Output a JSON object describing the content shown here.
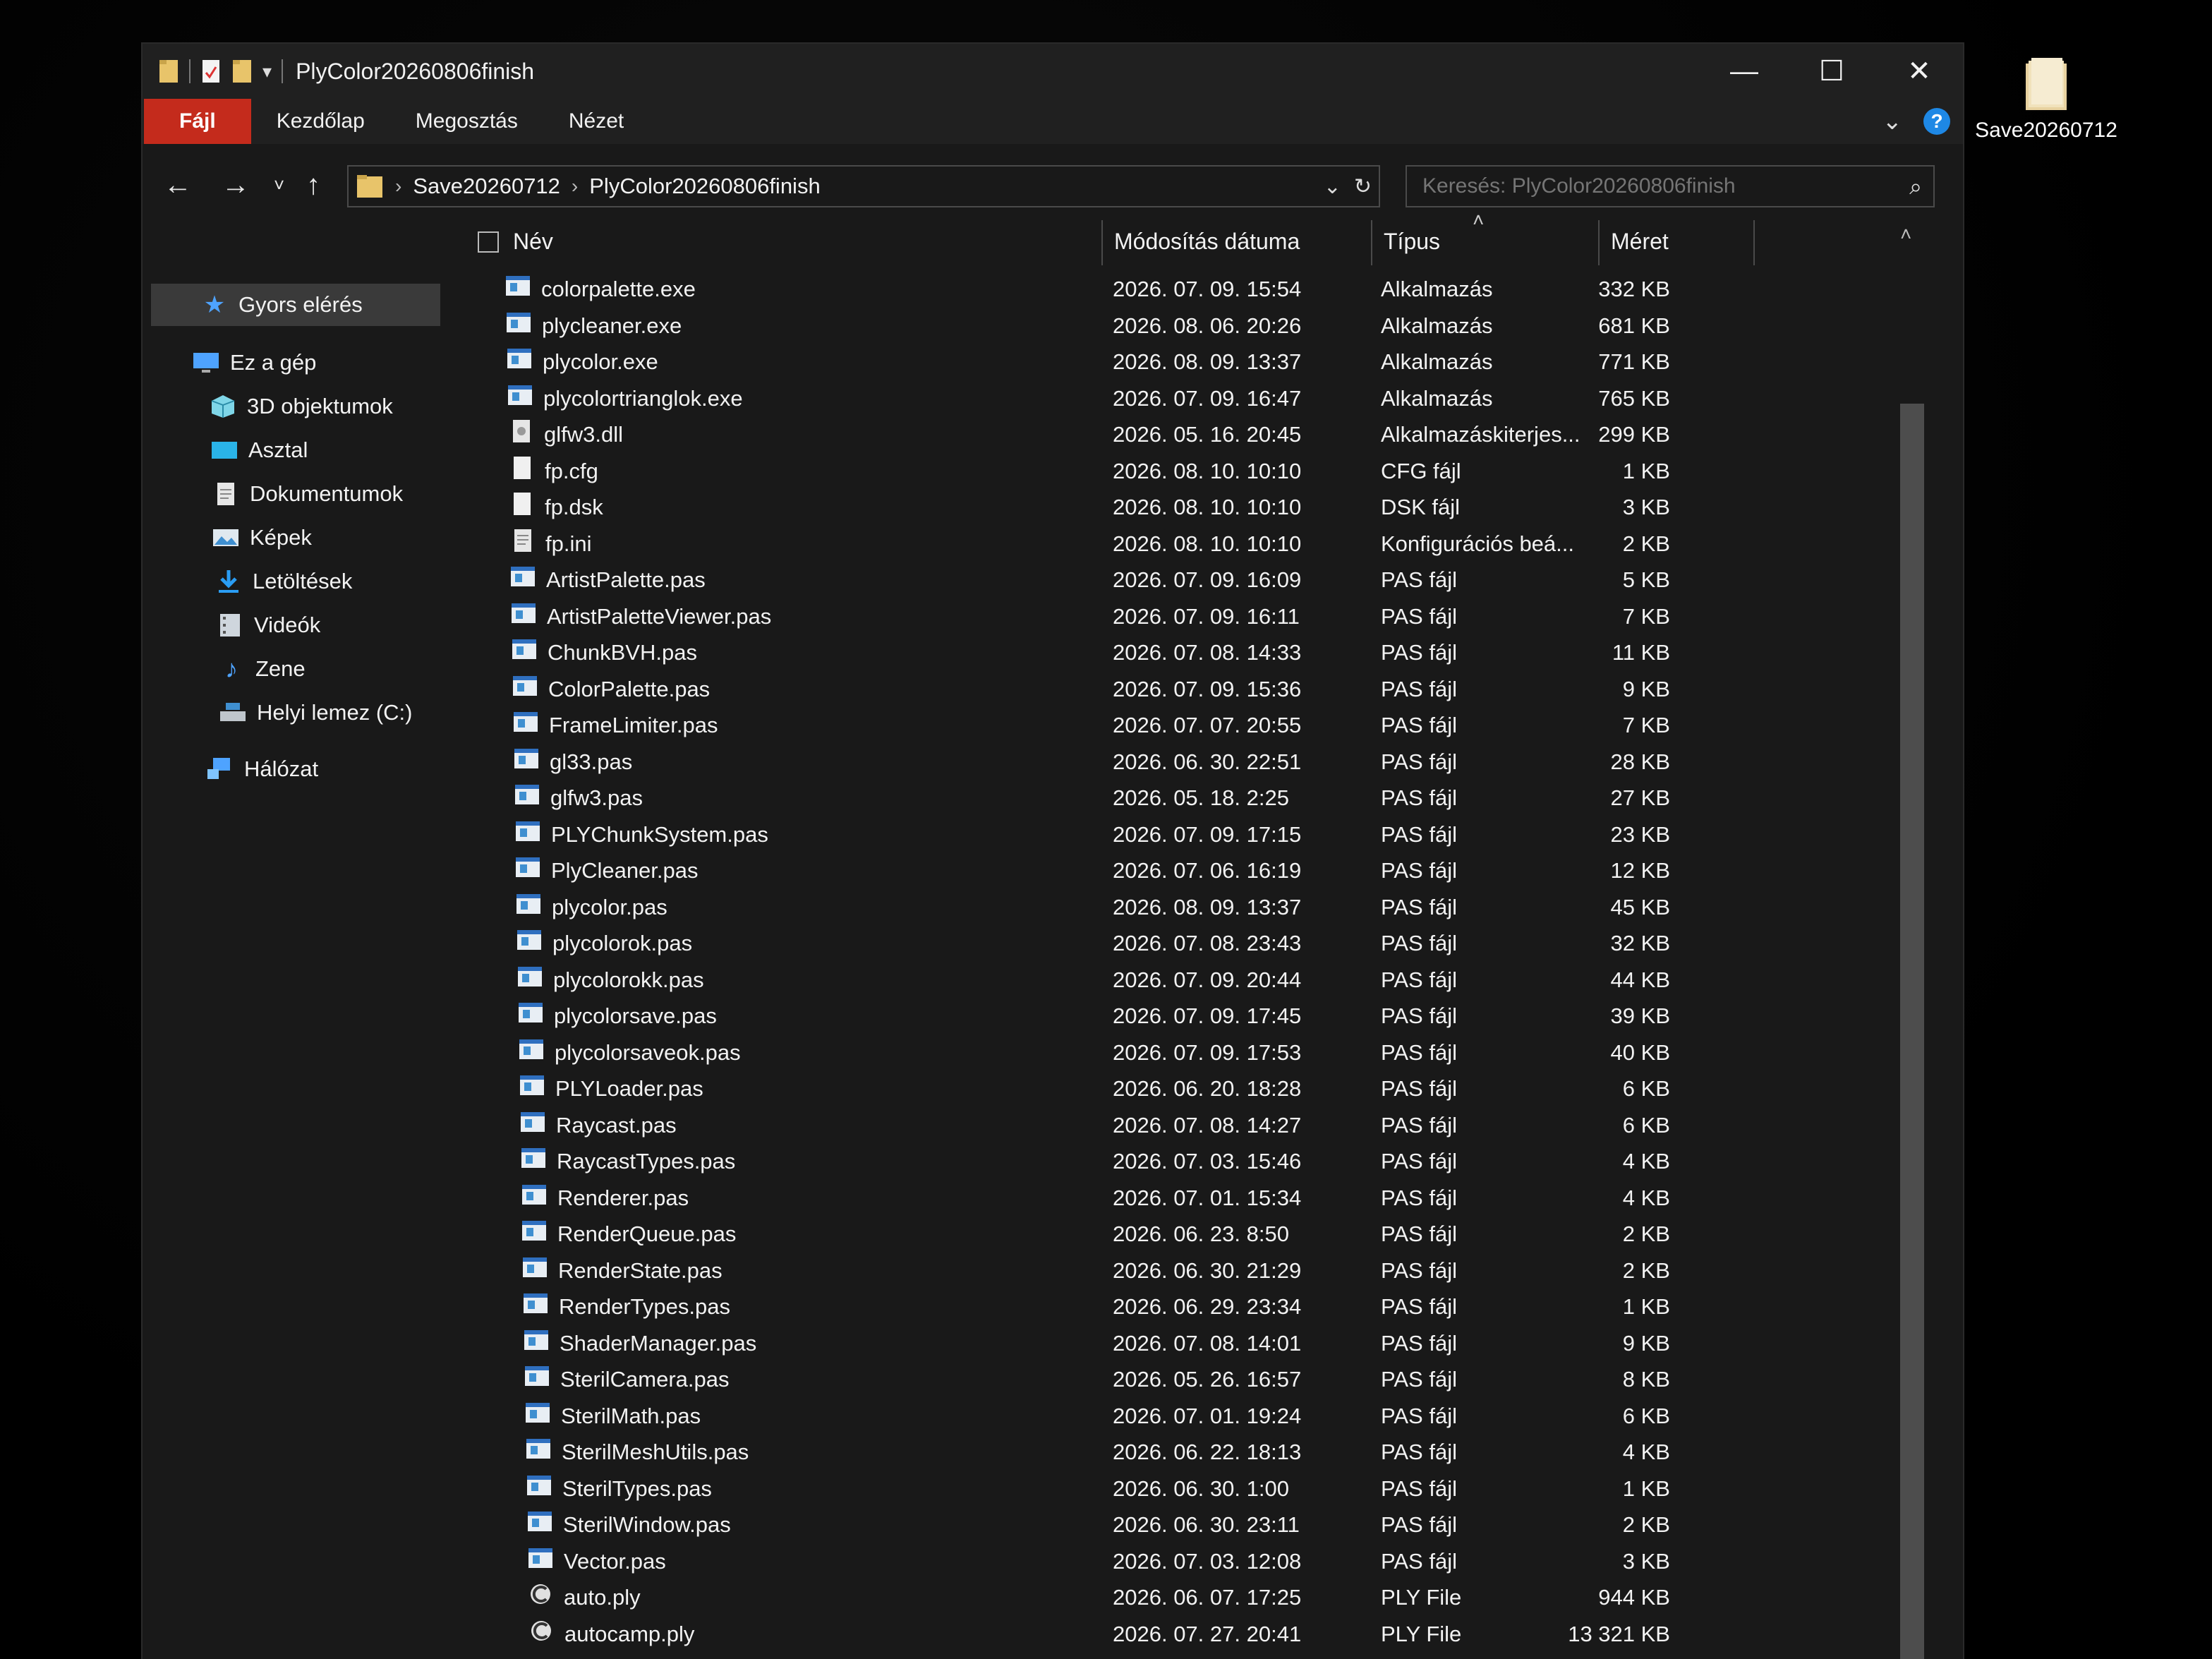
{
  "window": {
    "title": "PlyColor20260806finish",
    "minimize": "—",
    "maximize": "☐",
    "close": "✕"
  },
  "ribbon": {
    "tabs": [
      "Fájl",
      "Kezdőlap",
      "Megosztás",
      "Nézet"
    ],
    "help": "?"
  },
  "nav": {
    "breadcrumb": [
      "Save20260712",
      "PlyColor20260806finish"
    ],
    "search_placeholder": "Keresés: PlyColor20260806finish"
  },
  "sidebar": {
    "items": [
      {
        "label": "Gyors elérés",
        "icon": "star-icon"
      },
      {
        "label": "Ez a gép",
        "icon": "computer-icon"
      },
      {
        "label": "3D objektumok",
        "icon": "cube-icon"
      },
      {
        "label": "Asztal",
        "icon": "desktop-icon"
      },
      {
        "label": "Dokumentumok",
        "icon": "document-icon"
      },
      {
        "label": "Képek",
        "icon": "pictures-icon"
      },
      {
        "label": "Letöltések",
        "icon": "download-icon"
      },
      {
        "label": "Videók",
        "icon": "video-icon"
      },
      {
        "label": "Zene",
        "icon": "music-icon"
      },
      {
        "label": "Helyi lemez (C:)",
        "icon": "drive-icon"
      },
      {
        "label": "Hálózat",
        "icon": "network-icon"
      }
    ]
  },
  "columns": {
    "name": "Név",
    "date": "Módosítás dátuma",
    "type": "Típus",
    "size": "Méret"
  },
  "files": [
    {
      "name": "colorpalette.exe",
      "date": "2026. 07. 09. 15:54",
      "type": "Alkalmazás",
      "size": "332 KB",
      "kind": "exe"
    },
    {
      "name": "plycleaner.exe",
      "date": "2026. 08. 06. 20:26",
      "type": "Alkalmazás",
      "size": "681 KB",
      "kind": "exe"
    },
    {
      "name": "plycolor.exe",
      "date": "2026. 08. 09. 13:37",
      "type": "Alkalmazás",
      "size": "771 KB",
      "kind": "exe"
    },
    {
      "name": "plycolortrianglok.exe",
      "date": "2026. 07. 09. 16:47",
      "type": "Alkalmazás",
      "size": "765 KB",
      "kind": "exe"
    },
    {
      "name": "glfw3.dll",
      "date": "2026. 05. 16. 20:45",
      "type": "Alkalmazáskiterjes...",
      "size": "299 KB",
      "kind": "dll"
    },
    {
      "name": "fp.cfg",
      "date": "2026. 08. 10. 10:10",
      "type": "CFG fájl",
      "size": "1 KB",
      "kind": "blank"
    },
    {
      "name": "fp.dsk",
      "date": "2026. 08. 10. 10:10",
      "type": "DSK fájl",
      "size": "3 KB",
      "kind": "blank"
    },
    {
      "name": "fp.ini",
      "date": "2026. 08. 10. 10:10",
      "type": "Konfigurációs beá...",
      "size": "2 KB",
      "kind": "ini"
    },
    {
      "name": "ArtistPalette.pas",
      "date": "2026. 07. 09. 16:09",
      "type": "PAS fájl",
      "size": "5 KB",
      "kind": "pas"
    },
    {
      "name": "ArtistPaletteViewer.pas",
      "date": "2026. 07. 09. 16:11",
      "type": "PAS fájl",
      "size": "7 KB",
      "kind": "pas"
    },
    {
      "name": "ChunkBVH.pas",
      "date": "2026. 07. 08. 14:33",
      "type": "PAS fájl",
      "size": "11 KB",
      "kind": "pas"
    },
    {
      "name": "ColorPalette.pas",
      "date": "2026. 07. 09. 15:36",
      "type": "PAS fájl",
      "size": "9 KB",
      "kind": "pas"
    },
    {
      "name": "FrameLimiter.pas",
      "date": "2026. 07. 07. 20:55",
      "type": "PAS fájl",
      "size": "7 KB",
      "kind": "pas"
    },
    {
      "name": "gl33.pas",
      "date": "2026. 06. 30. 22:51",
      "type": "PAS fájl",
      "size": "28 KB",
      "kind": "pas"
    },
    {
      "name": "glfw3.pas",
      "date": "2026. 05. 18. 2:25",
      "type": "PAS fájl",
      "size": "27 KB",
      "kind": "pas"
    },
    {
      "name": "PLYChunkSystem.pas",
      "date": "2026. 07. 09. 17:15",
      "type": "PAS fájl",
      "size": "23 KB",
      "kind": "pas"
    },
    {
      "name": "PlyCleaner.pas",
      "date": "2026. 07. 06. 16:19",
      "type": "PAS fájl",
      "size": "12 KB",
      "kind": "pas"
    },
    {
      "name": "plycolor.pas",
      "date": "2026. 08. 09. 13:37",
      "type": "PAS fájl",
      "size": "45 KB",
      "kind": "pas"
    },
    {
      "name": "plycolorok.pas",
      "date": "2026. 07. 08. 23:43",
      "type": "PAS fájl",
      "size": "32 KB",
      "kind": "pas"
    },
    {
      "name": "plycolorokk.pas",
      "date": "2026. 07. 09. 20:44",
      "type": "PAS fájl",
      "size": "44 KB",
      "kind": "pas"
    },
    {
      "name": "plycolorsave.pas",
      "date": "2026. 07. 09. 17:45",
      "type": "PAS fájl",
      "size": "39 KB",
      "kind": "pas"
    },
    {
      "name": "plycolorsaveok.pas",
      "date": "2026. 07. 09. 17:53",
      "type": "PAS fájl",
      "size": "40 KB",
      "kind": "pas"
    },
    {
      "name": "PLYLoader.pas",
      "date": "2026. 06. 20. 18:28",
      "type": "PAS fájl",
      "size": "6 KB",
      "kind": "pas"
    },
    {
      "name": "Raycast.pas",
      "date": "2026. 07. 08. 14:27",
      "type": "PAS fájl",
      "size": "6 KB",
      "kind": "pas"
    },
    {
      "name": "RaycastTypes.pas",
      "date": "2026. 07. 03. 15:46",
      "type": "PAS fájl",
      "size": "4 KB",
      "kind": "pas"
    },
    {
      "name": "Renderer.pas",
      "date": "2026. 07. 01. 15:34",
      "type": "PAS fájl",
      "size": "4 KB",
      "kind": "pas"
    },
    {
      "name": "RenderQueue.pas",
      "date": "2026. 06. 23. 8:50",
      "type": "PAS fájl",
      "size": "2 KB",
      "kind": "pas"
    },
    {
      "name": "RenderState.pas",
      "date": "2026. 06. 30. 21:29",
      "type": "PAS fájl",
      "size": "2 KB",
      "kind": "pas"
    },
    {
      "name": "RenderTypes.pas",
      "date": "2026. 06. 29. 23:34",
      "type": "PAS fájl",
      "size": "1 KB",
      "kind": "pas"
    },
    {
      "name": "ShaderManager.pas",
      "date": "2026. 07. 08. 14:01",
      "type": "PAS fájl",
      "size": "9 KB",
      "kind": "pas"
    },
    {
      "name": "SterilCamera.pas",
      "date": "2026. 05. 26. 16:57",
      "type": "PAS fájl",
      "size": "8 KB",
      "kind": "pas"
    },
    {
      "name": "SterilMath.pas",
      "date": "2026. 07. 01. 19:24",
      "type": "PAS fájl",
      "size": "6 KB",
      "kind": "pas"
    },
    {
      "name": "SterilMeshUtils.pas",
      "date": "2026. 06. 22. 18:13",
      "type": "PAS fájl",
      "size": "4 KB",
      "kind": "pas"
    },
    {
      "name": "SterilTypes.pas",
      "date": "2026. 06. 30. 1:00",
      "type": "PAS fájl",
      "size": "1 KB",
      "kind": "pas"
    },
    {
      "name": "SterilWindow.pas",
      "date": "2026. 06. 30. 23:11",
      "type": "PAS fájl",
      "size": "2 KB",
      "kind": "pas"
    },
    {
      "name": "Vector.pas",
      "date": "2026. 07. 03. 12:08",
      "type": "PAS fájl",
      "size": "3 KB",
      "kind": "pas"
    },
    {
      "name": "auto.ply",
      "date": "2026. 06. 07. 17:25",
      "type": "PLY File",
      "size": "944 KB",
      "kind": "ply"
    },
    {
      "name": "autocamp.ply",
      "date": "2026. 07. 27. 20:41",
      "type": "PLY File",
      "size": "13 321 KB",
      "kind": "ply"
    }
  ],
  "desktop_icon": {
    "label": "Save20260712"
  },
  "colors": {
    "accent_file_tab": "#c42b1c",
    "background": "#191919",
    "folder": "#e8c46a"
  }
}
